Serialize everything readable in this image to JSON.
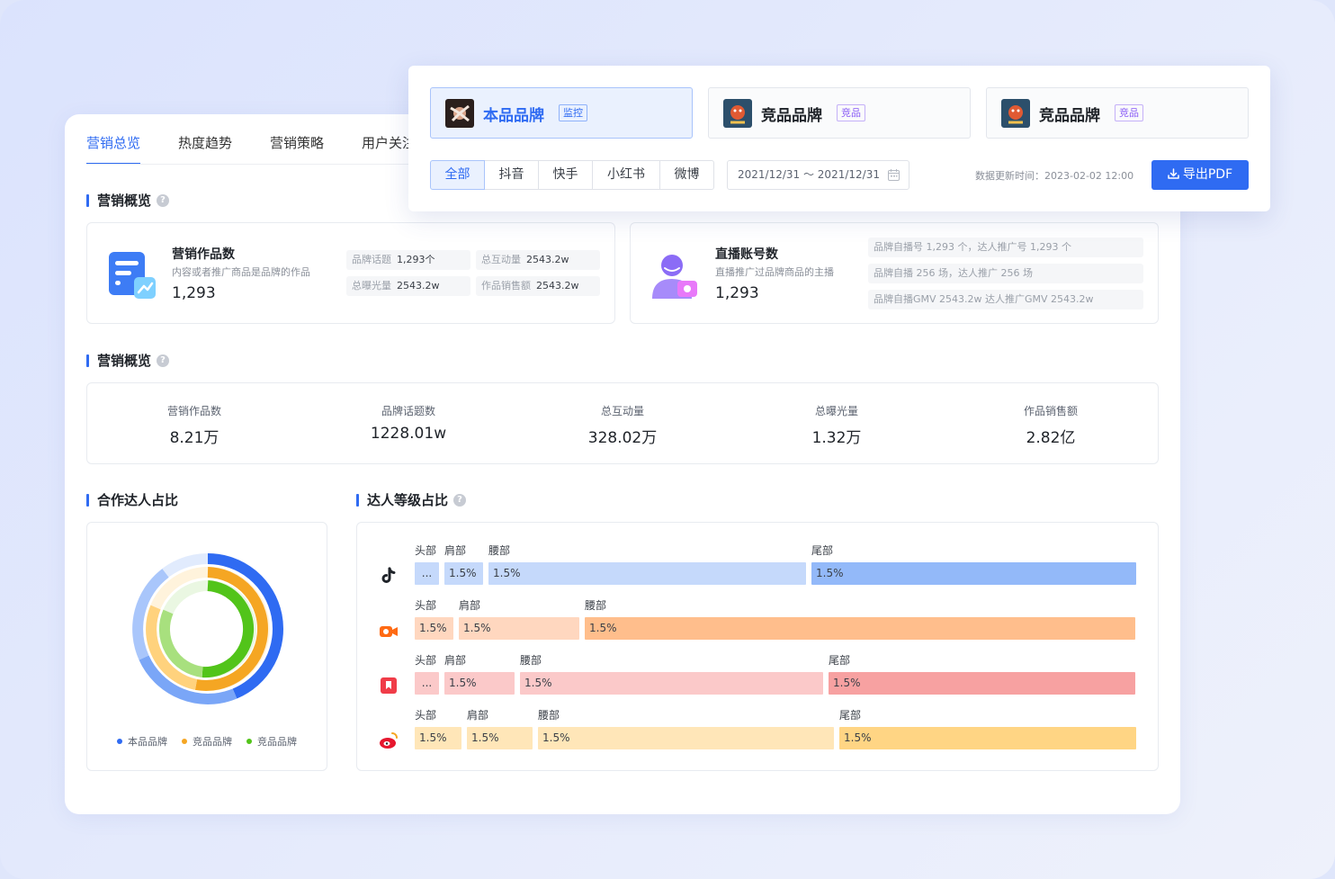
{
  "tabs": [
    "营销总览",
    "热度趋势",
    "营销策略",
    "用户关注"
  ],
  "brands": [
    {
      "name": "本品品牌",
      "badge": "监控"
    },
    {
      "name": "竞品品牌",
      "badge": "竞品"
    },
    {
      "name": "竞品品牌",
      "badge": "竞品"
    }
  ],
  "platform_filters": [
    "全部",
    "抖音",
    "快手",
    "小红书",
    "微博"
  ],
  "date_range": "2021/12/31 ～ 2021/12/31",
  "update_time": "数据更新时间：2023-02-02 12:00",
  "export_label": "导出PDF",
  "section1": {
    "title": "营销概览",
    "works": {
      "name": "营销作品数",
      "desc": "内容或者推广商品是品牌的作品",
      "value": "1,293",
      "chips": [
        {
          "label": "品牌话题",
          "value": "1,293个"
        },
        {
          "label": "总互动量",
          "value": "2543.2w"
        },
        {
          "label": "总曝光量",
          "value": "2543.2w"
        },
        {
          "label": "作品销售额",
          "value": "2543.2w"
        }
      ]
    },
    "live": {
      "name": "直播账号数",
      "desc": "直播推广过品牌商品的主播",
      "value": "1,293",
      "rows": [
        "品牌自播号 1,293 个，达人推广号 1,293 个",
        "品牌自播 256 场，达人推广 256 场",
        "品牌自播GMV 2543.2w 达人推广GMV 2543.2w"
      ]
    }
  },
  "section2": {
    "title": "营销概览",
    "metrics": [
      {
        "label": "营销作品数",
        "value": "8.21万"
      },
      {
        "label": "品牌话题数",
        "value": "1228.01w"
      },
      {
        "label": "总互动量",
        "value": "328.02万"
      },
      {
        "label": "总曝光量",
        "value": "1.32万"
      },
      {
        "label": "作品销售额",
        "value": "2.82亿"
      }
    ]
  },
  "section3": {
    "title": "合作达人占比",
    "legend": [
      {
        "name": "本品品牌",
        "color": "#2f6bf2"
      },
      {
        "name": "竞品品牌",
        "color": "#f5a623"
      },
      {
        "name": "竞品品牌",
        "color": "#52c41a"
      }
    ]
  },
  "section4": {
    "title": "达人等级占比",
    "platforms": [
      {
        "icon": "douyin-icon",
        "segments": [
          {
            "label": "头部",
            "value": "...",
            "share": 0.035,
            "color": "#c5d9fb"
          },
          {
            "label": "肩部",
            "value": "1.5%",
            "share": 0.055,
            "color": "#c5d9fb"
          },
          {
            "label": "腰部",
            "value": "1.5%",
            "share": 0.45,
            "color": "#c5d9fb"
          },
          {
            "label": "尾部",
            "value": "1.5%",
            "share": 0.46,
            "color": "#93b9f9"
          }
        ]
      },
      {
        "icon": "kuaishou-icon",
        "segments": [
          {
            "label": "头部",
            "value": "1.5%",
            "share": 0.055,
            "color": "#ffd7bf"
          },
          {
            "label": "肩部",
            "value": "1.5%",
            "share": 0.17,
            "color": "#ffd7bf"
          },
          {
            "label": "腰部",
            "value": "1.5%",
            "share": 0.775,
            "color": "#ffbe8c"
          }
        ]
      },
      {
        "icon": "xiaohongshu-icon",
        "segments": [
          {
            "label": "头部",
            "value": "...",
            "share": 0.035,
            "color": "#fbc9c9"
          },
          {
            "label": "肩部",
            "value": "1.5%",
            "share": 0.1,
            "color": "#fbc9c9"
          },
          {
            "label": "腰部",
            "value": "1.5%",
            "share": 0.43,
            "color": "#fbc9c9"
          },
          {
            "label": "尾部",
            "value": "1.5%",
            "share": 0.435,
            "color": "#f7a1a1"
          }
        ]
      },
      {
        "icon": "weibo-icon",
        "segments": [
          {
            "label": "头部",
            "value": "1.5%",
            "share": 0.066,
            "color": "#ffe6b8"
          },
          {
            "label": "肩部",
            "value": "1.5%",
            "share": 0.093,
            "color": "#ffe6b8"
          },
          {
            "label": "腰部",
            "value": "1.5%",
            "share": 0.42,
            "color": "#ffe6b8"
          },
          {
            "label": "尾部",
            "value": "1.5%",
            "share": 0.421,
            "color": "#ffd584"
          }
        ]
      }
    ]
  },
  "colors": {
    "accent": "#2f6bf2",
    "brand_self": "#2f6bf2",
    "brand_comp1": "#f5a623",
    "brand_comp2": "#52c41a"
  }
}
